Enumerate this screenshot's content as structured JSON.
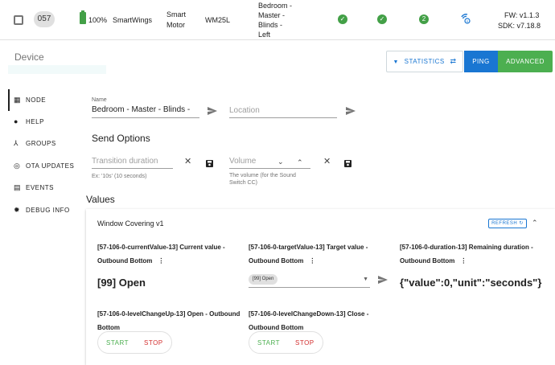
{
  "node_row": {
    "id": "057",
    "battery": "100%",
    "manufacturer": "SmartWings",
    "product_line1": "Smart",
    "product_line2": "Motor",
    "model": "WM25L",
    "name_lines": [
      "Bedroom -",
      "Master -",
      "Blinds -",
      "Left"
    ],
    "interview_count": "2",
    "fw": "FW: v1.1.3",
    "sdk": "SDK: v7.18.8"
  },
  "device": {
    "title": "Device",
    "statistics_label": "STATISTICS",
    "ping_label": "PING",
    "advanced_label": "ADVANCED"
  },
  "sidebar": {
    "items": [
      {
        "label": "NODE",
        "icon": "grid-icon"
      },
      {
        "label": "HELP",
        "icon": "help-icon"
      },
      {
        "label": "GROUPS",
        "icon": "groups-icon"
      },
      {
        "label": "OTA UPDATES",
        "icon": "ota-icon"
      },
      {
        "label": "EVENTS",
        "icon": "events-icon"
      },
      {
        "label": "DEBUG INFO",
        "icon": "bug-icon"
      }
    ]
  },
  "form": {
    "name_label": "Name",
    "name_value": "Bedroom - Master - Blinds -",
    "location_placeholder": "Location",
    "send_options_title": "Send Options",
    "transition_placeholder": "Transition duration",
    "transition_hint": "Ex: '10s' (10 seconds)",
    "volume_placeholder": "Volume",
    "volume_hint": "The volume (for the Sound Switch CC)"
  },
  "values": {
    "title": "Values",
    "card_title": "Window Covering v1",
    "refresh_label": "REFRESH",
    "current": {
      "label": "[57-106-0-currentValue-13] Current value - Outbound Bottom",
      "value": "[99] Open"
    },
    "target": {
      "label": "[57-106-0-targetValue-13] Target value - Outbound Bottom",
      "value": "[99] Open"
    },
    "duration": {
      "label": "[57-106-0-duration-13] Remaining duration - Outbound Bottom",
      "value": "{\"value\":0,\"unit\":\"seconds\"}"
    },
    "level_up": {
      "label": "[57-106-0-levelChangeUp-13] Open - Outbound Bottom",
      "start": "START",
      "stop": "STOP"
    },
    "level_down": {
      "label": "[57-106-0-levelChangeDown-13] Close - Outbound Bottom",
      "start": "START",
      "stop": "STOP"
    }
  },
  "colors": {
    "primary": "#1976d2",
    "success": "#4caf50",
    "danger": "#d32f2f"
  }
}
